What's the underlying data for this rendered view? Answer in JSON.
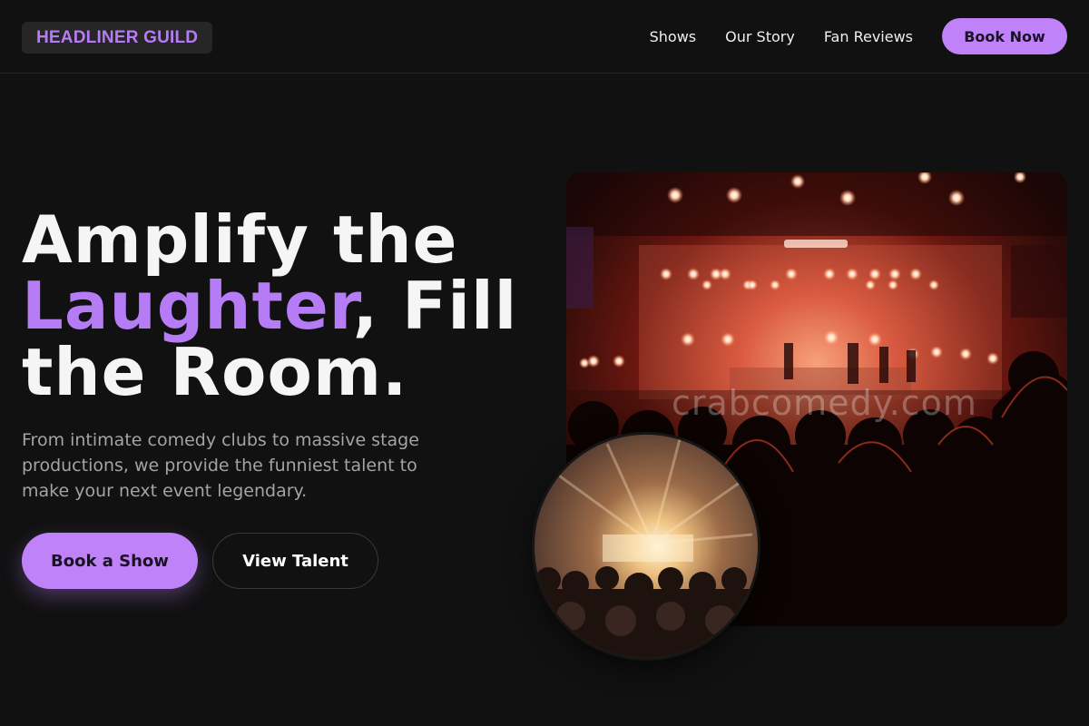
{
  "brand": {
    "name": "HEADLINER GUILD"
  },
  "nav": {
    "links": [
      {
        "label": "Shows"
      },
      {
        "label": "Our Story"
      },
      {
        "label": "Fan Reviews"
      }
    ],
    "cta_label": "Book Now"
  },
  "hero": {
    "headline_part1": "Amplify the",
    "headline_accent": "Laughter",
    "headline_part2": ", Fill the Room.",
    "subtext": "From intimate comedy clubs to massive stage productions, we provide the funniest talent to make your next event legendary.",
    "primary_cta": "Book a Show",
    "secondary_cta": "View Talent",
    "watermark": "crabcomedy.com"
  },
  "colors": {
    "background": "#111111",
    "accent": "#b57cf5",
    "button": "#bf82f8"
  },
  "images": {
    "main": "concert-stage-crowd-photo",
    "circle": "festival-lights-crowd-photo"
  }
}
